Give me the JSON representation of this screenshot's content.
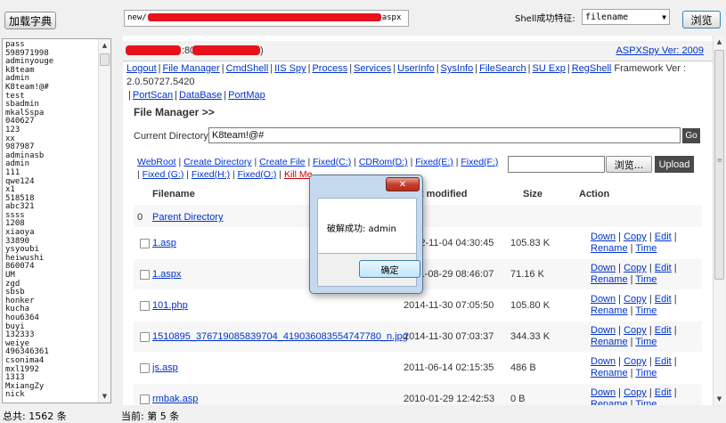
{
  "toolbar": {
    "load_dict_label": "加载字典",
    "url_prefix": "new/",
    "url_suffix": "aspx",
    "shell_feature_label": "Shell成功特征:",
    "shell_feature_value": "filename",
    "browse_label": "浏览"
  },
  "dictionary": {
    "lines": [
      "pass",
      "598971998",
      "adminyouge",
      "k8team",
      "admin",
      "K8team!@#",
      "test",
      "sbadmin",
      "mkalSspa",
      "040627",
      "123",
      "xx",
      "987987",
      "adminasb",
      "admin",
      "111",
      "qwe124",
      "x1",
      "518518",
      "abc321",
      "ssss",
      "1208",
      "xiaoya",
      "33890",
      "ysyoubi",
      "heiwushi",
      "860074",
      "UM",
      "zgd",
      "sbsb",
      "honker",
      "kucha",
      "hou6364",
      "buyi",
      "132333",
      "weiye",
      "496346361",
      "csonima4",
      "mxl1992",
      "1313",
      "MxiangZy",
      "nick"
    ]
  },
  "status": {
    "total": "总共: 1562 条",
    "current": "当前: 第 5 条"
  },
  "page": {
    "host_text": ":80(",
    "host_close": ")",
    "version": "ASPXSpy Ver: 2009",
    "menu_items": [
      "Logout",
      "File Manager",
      "CmdShell",
      "IIS Spy",
      "Process",
      "Services",
      "UserInfo",
      "SysInfo",
      "FileSearch",
      "SU Exp",
      "RegShell"
    ],
    "framework": "Framework Ver : 2.0.50727.5420",
    "menu_items2": [
      "PortScan",
      "DataBase",
      "PortMap"
    ],
    "file_manager_title": "File Manager >>",
    "current_directory_label": "Current Directory :",
    "current_directory_value": "K8team!@#",
    "go_label": "Go",
    "roots": [
      "WebRoot",
      "Create Directory",
      "Create File",
      "Fixed(C:)",
      "CDRom(D:)",
      "Fixed(E:)",
      "Fixed(F:)",
      "Fixed (G:)",
      "Fixed(H:)",
      "Fixed(O:)"
    ],
    "kill_me": "Kill Me",
    "browse_label": "浏览...",
    "upload_label": "Upload"
  },
  "table": {
    "headers": {
      "filename": "Filename",
      "modified": "Last modified",
      "size": "Size",
      "action": "Action"
    },
    "parent": {
      "index": "0",
      "name": "Parent Directory"
    },
    "rows": [
      {
        "name": "1.asp",
        "modified": "2012-11-04 04:30:45",
        "size": "105.83 K"
      },
      {
        "name": "1.aspx",
        "modified": "2011-08-29 08:46:07",
        "size": "71.16 K"
      },
      {
        "name": "101.php",
        "modified": "2014-11-30 07:05:50",
        "size": "105.80 K"
      },
      {
        "name": "1510895_376719085839704_419036083554747780_n.jpg",
        "modified": "2014-11-30 07:03:37",
        "size": "344.33 K"
      },
      {
        "name": "js.asp",
        "modified": "2011-06-14 02:15:35",
        "size": "486 B"
      },
      {
        "name": "rmbak.asp",
        "modified": "2010-01-29 12:42:53",
        "size": "0 B"
      }
    ],
    "actions": {
      "down": "Down",
      "copy": "Copy",
      "edit": "Edit",
      "rename": "Rename",
      "time": "Time"
    }
  },
  "dialog": {
    "message": "破解成功: admin",
    "ok_label": "确定",
    "close_glyph": "✕"
  },
  "colors": {
    "link": "#0033cc",
    "redaction": "#e8121b",
    "kill": "#cc0000",
    "dark_button": "#4a4a4a"
  }
}
